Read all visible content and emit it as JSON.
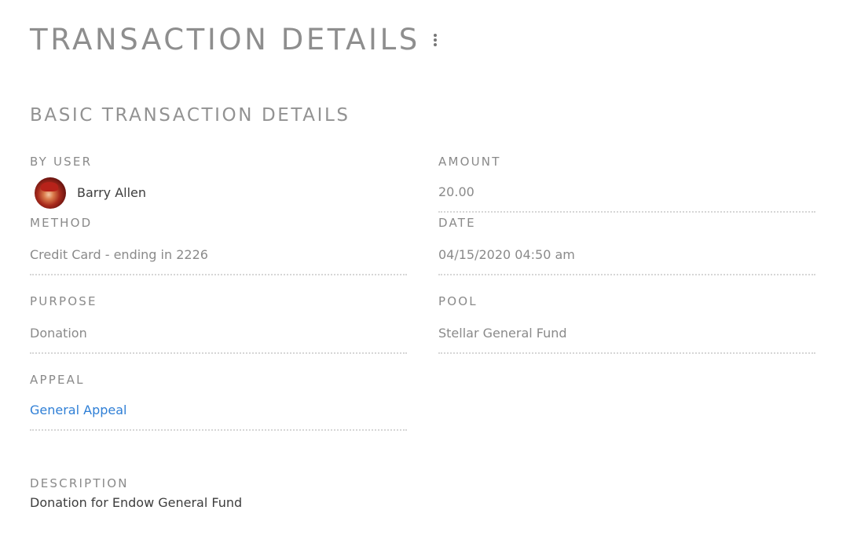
{
  "header": {
    "title": "TRANSACTION DETAILS",
    "menu_icon": "kebab-menu-icon"
  },
  "section": {
    "title": "BASIC TRANSACTION DETAILS"
  },
  "fields": {
    "by_user": {
      "label": "BY USER",
      "name": "Barry Allen",
      "avatar_icon": "user-avatar"
    },
    "amount": {
      "label": "AMOUNT",
      "value": "20.00"
    },
    "method": {
      "label": "METHOD",
      "value": "Credit Card - ending in 2226"
    },
    "date": {
      "label": "DATE",
      "value": "04/15/2020 04:50 am"
    },
    "purpose": {
      "label": "PURPOSE",
      "value": "Donation"
    },
    "pool": {
      "label": "POOL",
      "value": "Stellar General Fund"
    },
    "appeal": {
      "label": "APPEAL",
      "value": "General Appeal"
    },
    "description": {
      "label": "DESCRIPTION",
      "value": "Donation for Endow General Fund"
    }
  },
  "colors": {
    "link": "#2f7fd6",
    "label": "#8a8a8a",
    "title": "#8e8e8e",
    "divider": "#d6d6d6"
  }
}
